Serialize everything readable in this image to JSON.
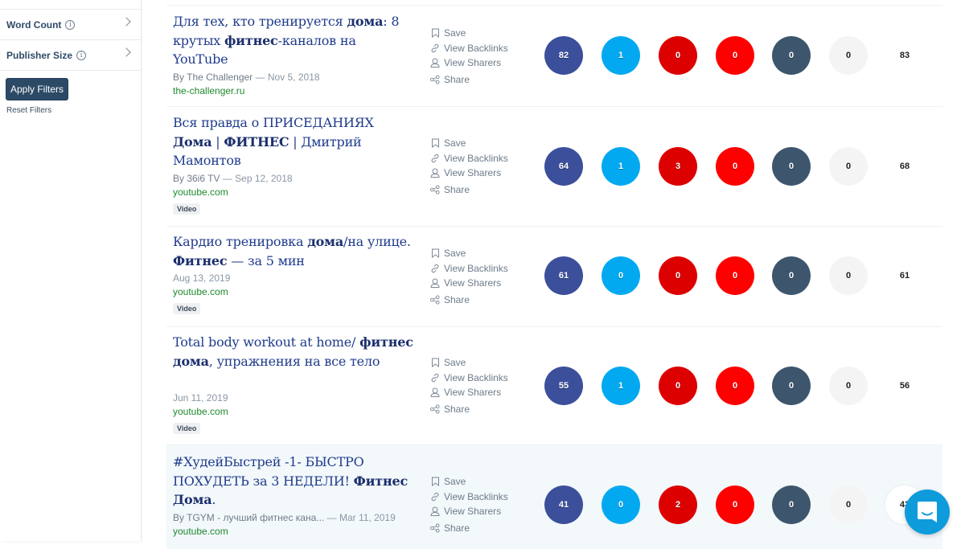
{
  "sidebar": {
    "filters": [
      {
        "label": "Word Count",
        "info_icon": "info-icon",
        "chevron_icon": "chevron-right-icon"
      },
      {
        "label": "Publisher Size",
        "info_icon": "info-icon",
        "chevron_icon": "chevron-right-icon"
      }
    ],
    "apply_label": "Apply Filters",
    "reset_label": "Reset Filters"
  },
  "actions": {
    "save": "Save",
    "backlinks": "View Backlinks",
    "sharers": "View Sharers",
    "share": "Share"
  },
  "colors": {
    "facebook": "#3b4f9b",
    "twitter": "#03a9f0",
    "pinterest": "#dd0000",
    "reddit": "#ff0000",
    "tumblr": "#3d566e",
    "other": "#f4f4f4",
    "title": "#1f3b8c",
    "domain": "#1f8a2f",
    "chat": "#0e9bdb"
  },
  "results": [
    {
      "title_parts": [
        [
          "Для тех, кто тренируется ",
          false
        ],
        [
          "дома",
          true
        ],
        [
          ": 8 крутых ",
          false
        ],
        [
          "фитнес",
          true
        ],
        [
          "-каналов на YouTube",
          false
        ]
      ],
      "author": "By The Challenger",
      "date": "Nov 5, 2018",
      "domain": "the-challenger.ru",
      "badge": null,
      "metrics": [
        "82",
        "1",
        "0",
        "0",
        "0",
        "0"
      ],
      "total": "83"
    },
    {
      "title_parts": [
        [
          "Вся правда о ПРИСЕДАНИЯХ ",
          false
        ],
        [
          "Дома",
          true
        ],
        [
          " | ",
          false
        ],
        [
          "ФИТНЕС",
          true
        ],
        [
          " | Дмитрий Мамонтов",
          false
        ]
      ],
      "author": "By 36i6 TV",
      "date": "Sep 12, 2018",
      "domain": "youtube.com",
      "badge": "Video",
      "metrics": [
        "64",
        "1",
        "3",
        "0",
        "0",
        "0"
      ],
      "total": "68"
    },
    {
      "title_parts": [
        [
          "Кардио тренировка ",
          false
        ],
        [
          "дома",
          true
        ],
        [
          "/на улице. ",
          false
        ],
        [
          "Фитнес",
          true
        ],
        [
          " — за 5 мин",
          false
        ]
      ],
      "author": null,
      "date": "Aug 13, 2019",
      "domain": "youtube.com",
      "badge": "Video",
      "metrics": [
        "61",
        "0",
        "0",
        "0",
        "0",
        "0"
      ],
      "total": "61"
    },
    {
      "title_parts": [
        [
          "Total body workout at home/ ",
          false
        ],
        [
          "фитнес дома",
          true
        ],
        [
          ", упражнения на все тело",
          false
        ]
      ],
      "author": null,
      "date": "Jun 11, 2019",
      "domain": "youtube.com",
      "badge": "Video",
      "metrics": [
        "55",
        "1",
        "0",
        "0",
        "0",
        "0"
      ],
      "total": "56"
    },
    {
      "title_parts": [
        [
          "#ХудейБыстрей -1- БЫСТРО ПОХУДЕТЬ за 3 НЕДЕЛИ! ",
          false
        ],
        [
          "Фитнес Дома",
          true
        ],
        [
          ".",
          false
        ]
      ],
      "author": "By TGYM - лучший фитнес кана...",
      "date": "Mar 11, 2019",
      "domain": "youtube.com",
      "badge": null,
      "metrics": [
        "41",
        "0",
        "2",
        "0",
        "0",
        "0"
      ],
      "total": "43"
    }
  ]
}
